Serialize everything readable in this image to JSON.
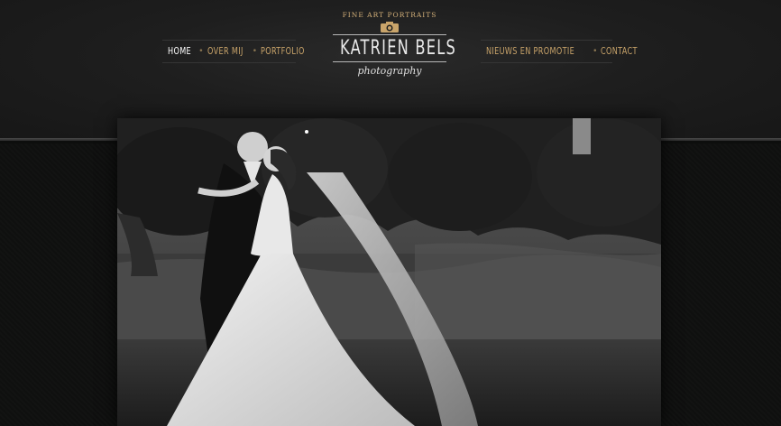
{
  "nav": {
    "left": [
      {
        "label": "HOME",
        "active": true
      },
      {
        "label": "OVER MIJ",
        "active": false
      },
      {
        "label": "PORTFOLIO",
        "active": false
      }
    ],
    "right": [
      {
        "label": "NIEUWS EN PROMOTIE",
        "active": false
      },
      {
        "label": "CONTACT",
        "active": false
      }
    ],
    "separator": "•"
  },
  "logo": {
    "tagline": "FINE ART PORTRAITS",
    "name": "KATRIEN BELS",
    "subtitle": "photography",
    "icon": "camera-icon"
  },
  "hero": {
    "subject": "black-and-white wedding photo of a couple kissing in a garden"
  },
  "colors": {
    "accent": "#c9a46a",
    "header_bg": "#1e1e1e",
    "page_bg": "#0f100f",
    "active": "#ffffff"
  }
}
